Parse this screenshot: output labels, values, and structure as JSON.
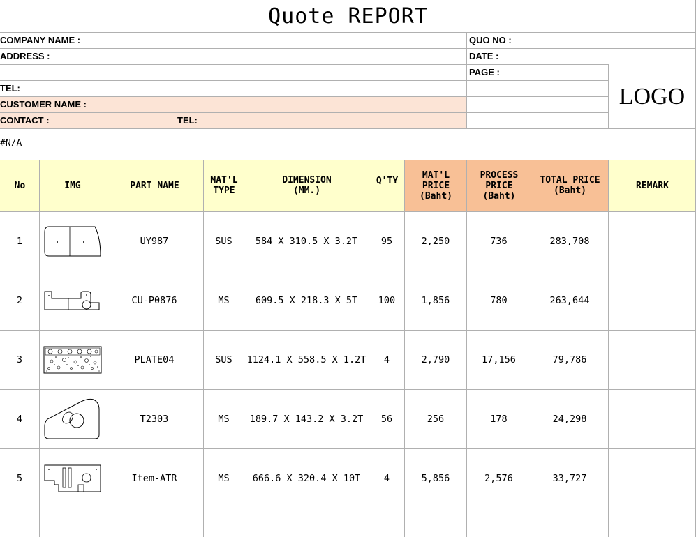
{
  "title": "Quote REPORT",
  "header": {
    "company_name_label": "COMPANY NAME :",
    "address_label": "ADDRESS :",
    "tel_label": "TEL:",
    "customer_name_label": "CUSTOMER NAME :",
    "contact_label": "CONTACT :",
    "contact_tel_label": "TEL:",
    "quo_no_label": "QUO NO :",
    "date_label": "DATE :",
    "page_label": "PAGE :",
    "logo_text": "LOGO",
    "error_text": "#N/A"
  },
  "table": {
    "columns": {
      "no": "No",
      "img": "IMG",
      "part_name": "PART NAME",
      "matl_type": "MAT'L\nTYPE",
      "dimension": "DIMENSION\n(MM.)",
      "qty": "Q'TY",
      "matl_price": "MAT'L\nPRICE\n(Baht)",
      "process_price": "PROCESS\nPRICE\n(Baht)",
      "total_price": "TOTAL PRICE\n(Baht)",
      "remark": "REMARK"
    },
    "rows": [
      {
        "no": "1",
        "img": "plate-two-holes",
        "part_name": "UY987",
        "matl_type": "SUS",
        "dimension": "584 X 310.5 X 3.2T",
        "qty": "95",
        "matl_price": "2,250",
        "process_price": "736",
        "total_price": "283,708",
        "remark": ""
      },
      {
        "no": "2",
        "img": "bracket-l-shape",
        "part_name": "CU-P0876",
        "matl_type": "MS",
        "dimension": "609.5 X 218.3 X 5T",
        "qty": "100",
        "matl_price": "1,856",
        "process_price": "780",
        "total_price": "263,644",
        "remark": ""
      },
      {
        "no": "3",
        "img": "perforated-plate",
        "part_name": "PLATE04",
        "matl_type": "SUS",
        "dimension": "1124.1 X 558.5 X 1.2T",
        "qty": "4",
        "matl_price": "2,790",
        "process_price": "17,156",
        "total_price": "79,786",
        "remark": ""
      },
      {
        "no": "4",
        "img": "curved-plate-hole",
        "part_name": "T2303",
        "matl_type": "MS",
        "dimension": "189.7 X 143.2 X 3.2T",
        "qty": "56",
        "matl_price": "256",
        "process_price": "178",
        "total_price": "24,298",
        "remark": ""
      },
      {
        "no": "5",
        "img": "slotted-plate",
        "part_name": "Item-ATR",
        "matl_type": "MS",
        "dimension": "666.6 X 320.4 X 10T",
        "qty": "4",
        "matl_price": "5,856",
        "process_price": "2,576",
        "total_price": "33,727",
        "remark": ""
      }
    ]
  }
}
